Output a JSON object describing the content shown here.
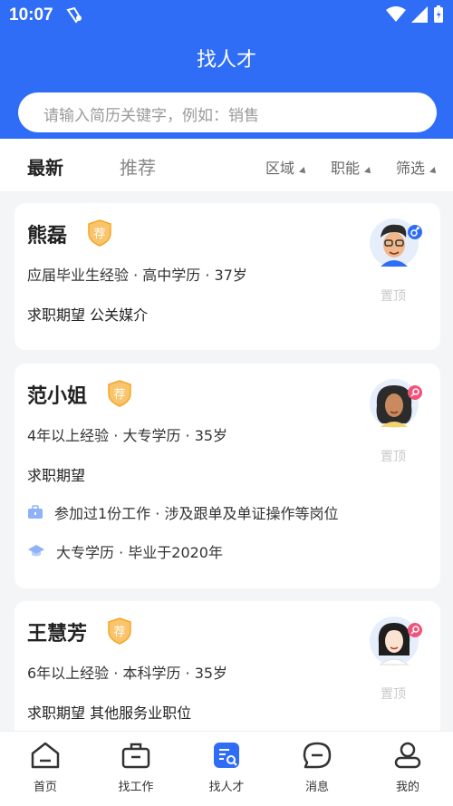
{
  "status": {
    "time": "10:07"
  },
  "header": {
    "title": "找人才"
  },
  "search": {
    "placeholder": "请输入简历关键字，例如：销售"
  },
  "tabs": {
    "newest": "最新",
    "recommend": "推荐"
  },
  "filters": {
    "area": "区域",
    "function": "职能",
    "screen": "筛选"
  },
  "badge_text": "荐",
  "pin_label": "置顶",
  "cards": [
    {
      "name": "熊磊",
      "meta": "应届毕业生经验 · 高中学历 · 37岁",
      "expect": "求职期望 公关媒介",
      "gender": "male"
    },
    {
      "name": "范小姐",
      "meta": "4年以上经验 · 大专学历 · 35岁",
      "expect": "求职期望",
      "work": "参加过1份工作 · 涉及跟单及单证操作等岗位",
      "edu": "大专学历 · 毕业于2020年",
      "gender": "female"
    },
    {
      "name": "王慧芳",
      "meta": "6年以上经验 · 本科学历 · 35岁",
      "expect": "求职期望 其他服务业职位",
      "gender": "female"
    }
  ],
  "nav": {
    "home": "首页",
    "find_job": "找工作",
    "find_talent": "找人才",
    "messages": "消息",
    "mine": "我的"
  },
  "colors": {
    "primary": "#2f6df6",
    "badge": "#f5a623",
    "male": "#2f6df6",
    "female": "#f0547a"
  }
}
